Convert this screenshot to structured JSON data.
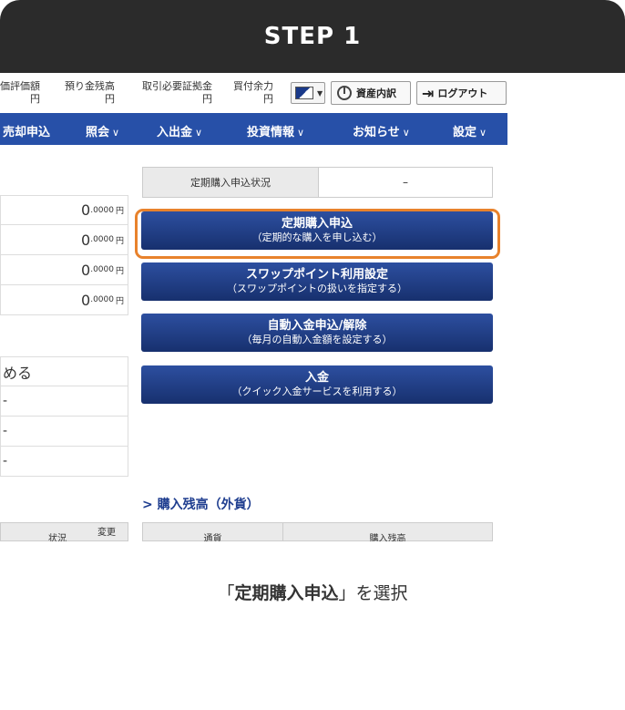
{
  "step": {
    "title": "STEP 1"
  },
  "status_bar": {
    "items": [
      {
        "label": "価評価額",
        "yen": "円"
      },
      {
        "label": "預り金残高",
        "yen": "円"
      },
      {
        "label": "取引必要証拠金",
        "yen": "円"
      },
      {
        "label": "買付余力",
        "yen": "円"
      }
    ],
    "assets_label": "資産内訳",
    "logout_label": "ログアウト"
  },
  "nav": {
    "items": [
      {
        "label": "売却申込",
        "chev": ""
      },
      {
        "label": "照会",
        "chev": "∨"
      },
      {
        "label": "入出金",
        "chev": "∨"
      },
      {
        "label": "投資情報",
        "chev": "∨"
      },
      {
        "label": "お知らせ",
        "chev": "∨"
      },
      {
        "label": "設定",
        "chev": "∨"
      }
    ]
  },
  "left_table": {
    "rows": [
      {
        "int": "0",
        "dec": ".0000",
        "yen": "円"
      },
      {
        "int": "0",
        "dec": ".0000",
        "yen": "円"
      },
      {
        "int": "0",
        "dec": ".0000",
        "yen": "円"
      },
      {
        "int": "0",
        "dec": ".0000",
        "yen": "円"
      }
    ]
  },
  "left_table2": {
    "rows": [
      "める",
      "-",
      "-",
      "-"
    ]
  },
  "periodic_status": {
    "label": "定期購入申込状況",
    "value": "–"
  },
  "buttons": [
    {
      "main": "定期購入申込",
      "sub": "（定期的な購入を申し込む）"
    },
    {
      "main": "スワップポイント利用設定",
      "sub": "（スワップポイントの扱いを指定する）"
    },
    {
      "main": "自動入金申込/解除",
      "sub": "（毎月の自動入金額を設定する）"
    },
    {
      "main": "入金",
      "sub": "（クイック入金サービスを利用する）"
    }
  ],
  "section": {
    "title": "> 購入残高（外貨）"
  },
  "bottom_left": {
    "col1": "状況",
    "col2": "変更"
  },
  "bottom_right": {
    "col1": "通貨",
    "col2": "購入残高"
  },
  "caption": {
    "quote_open": "「",
    "bold": "定期購入申込",
    "quote_close": "」",
    "rest": "を選択"
  }
}
